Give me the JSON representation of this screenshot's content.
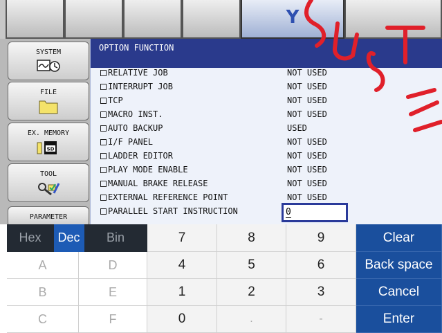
{
  "top_tabs": {
    "active_label": "Y"
  },
  "sidebar": {
    "items": [
      {
        "label": "SYSTEM"
      },
      {
        "label": "FILE"
      },
      {
        "label": "EX. MEMORY"
      },
      {
        "label": "TOOL"
      },
      {
        "label": "PARAMETER"
      }
    ],
    "sd_badge": "SD"
  },
  "panel": {
    "title": "OPTION FUNCTION",
    "options": [
      {
        "name": "RELATIVE JOB",
        "value": "NOT USED"
      },
      {
        "name": "INTERRUPT JOB",
        "value": "NOT USED"
      },
      {
        "name": "TCP",
        "value": "NOT USED"
      },
      {
        "name": "MACRO INST.",
        "value": "NOT USED"
      },
      {
        "name": "AUTO BACKUP",
        "value": "USED"
      },
      {
        "name": "I/F PANEL",
        "value": "NOT USED"
      },
      {
        "name": "LADDER EDITOR",
        "value": "NOT USED"
      },
      {
        "name": "PLAY MODE ENABLE",
        "value": "NOT USED"
      },
      {
        "name": "MANUAL BRAKE RELEASE",
        "value": "NOT USED"
      },
      {
        "name": "EXTERNAL REFERENCE POINT",
        "value": "NOT USED"
      },
      {
        "name": "PARALLEL START INSTRUCTION",
        "value": "0"
      }
    ]
  },
  "keypad": {
    "modes": {
      "hex": "Hex",
      "dec": "Dec",
      "bin": "Bin",
      "selected": "Dec"
    },
    "hex_keys": [
      "A",
      "D",
      "B",
      "E",
      "C",
      "F"
    ],
    "digits": [
      "7",
      "8",
      "9",
      "4",
      "5",
      "6",
      "1",
      "2",
      "3",
      "0"
    ],
    "dot": ".",
    "minus": "-",
    "actions": {
      "clear": "Clear",
      "backspace": "Back space",
      "cancel": "Cancel",
      "enter": "Enter"
    }
  },
  "colors": {
    "panel_header": "#2a3a8c",
    "action_key": "#1a4f9d",
    "mode_selected": "#1d5bb5",
    "watermark": "#e0202a"
  }
}
